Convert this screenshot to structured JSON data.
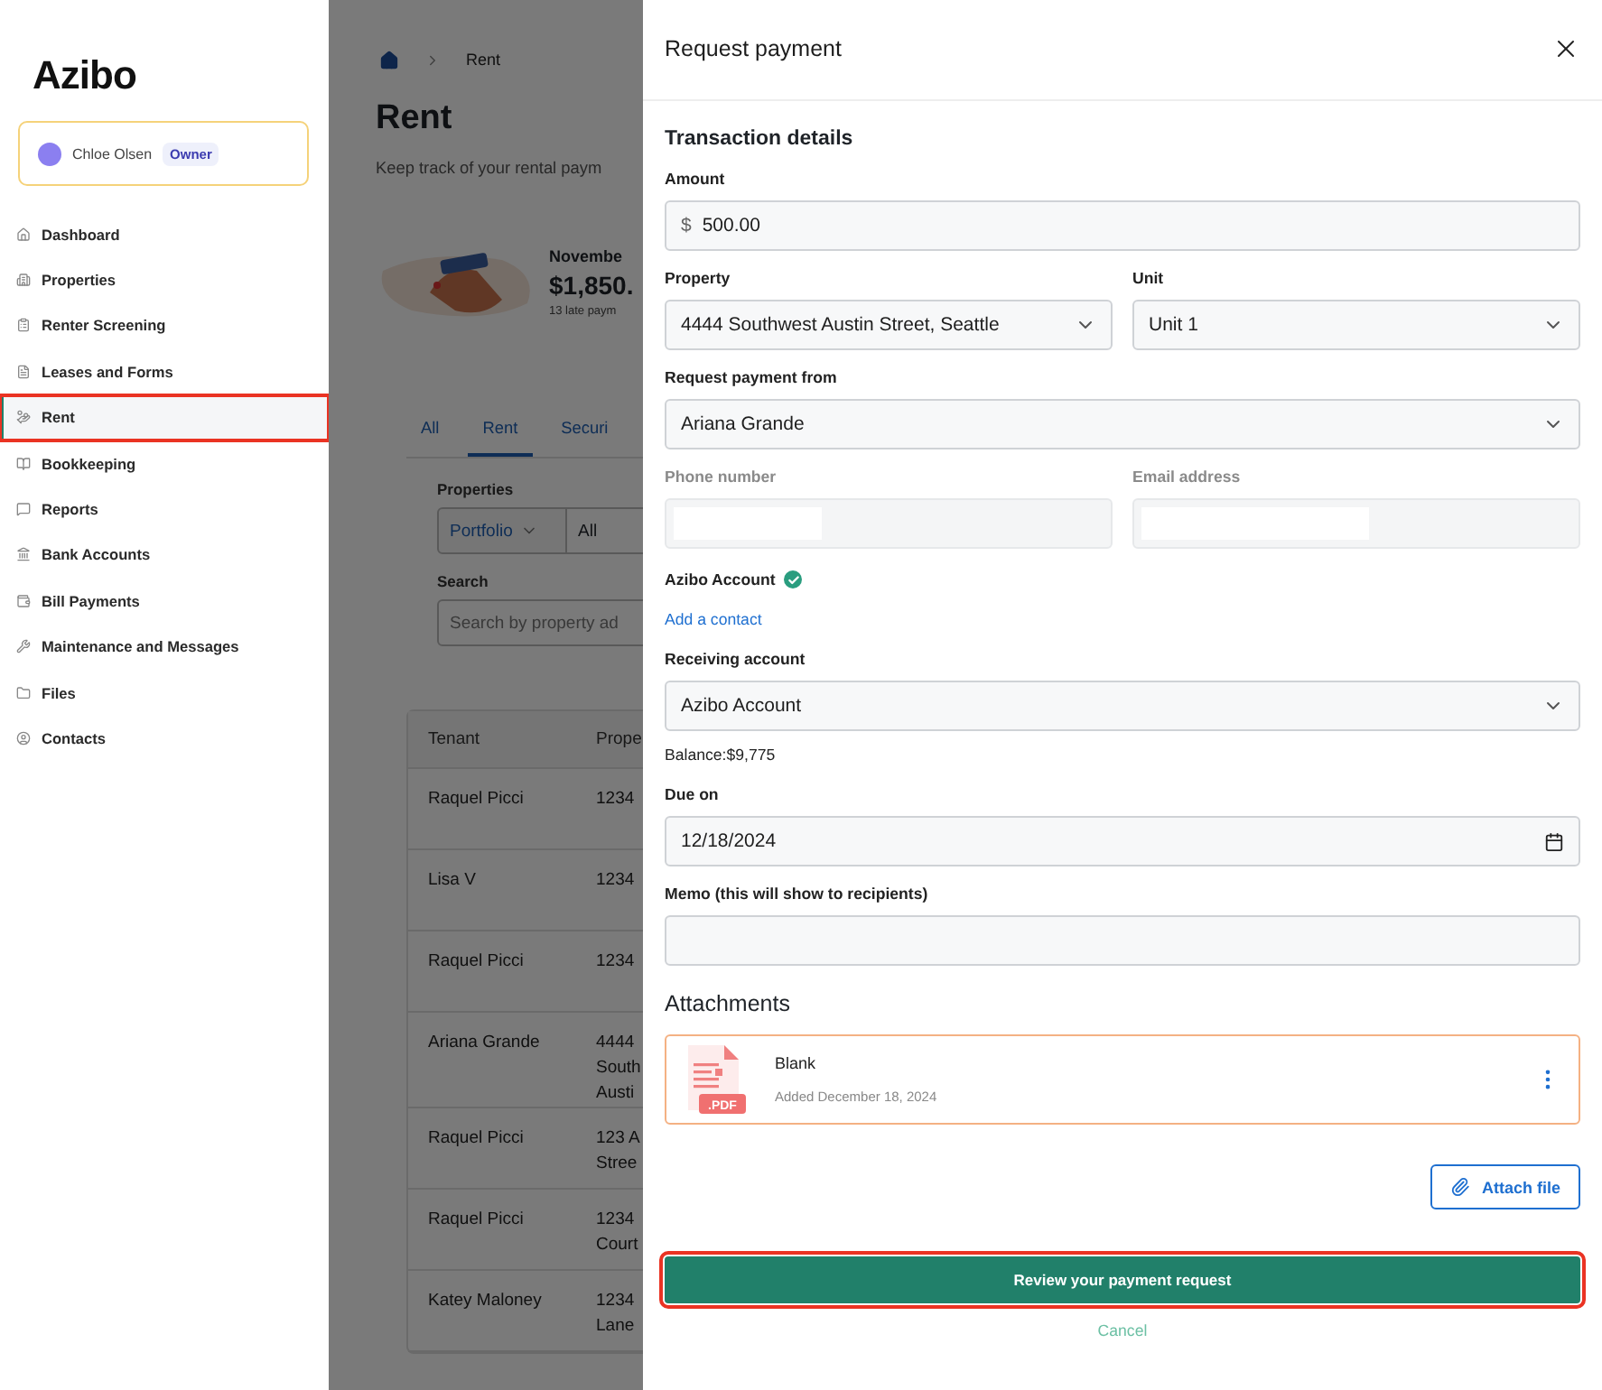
{
  "sidebar": {
    "logo": "Azibo",
    "user": {
      "name": "Chloe Olsen",
      "role": "Owner"
    },
    "items": [
      {
        "label": "Dashboard",
        "selected": false
      },
      {
        "label": "Properties",
        "selected": false
      },
      {
        "label": "Renter Screening",
        "selected": false
      },
      {
        "label": "Leases and Forms",
        "selected": false
      },
      {
        "label": "Rent",
        "selected": true
      },
      {
        "label": "Bookkeeping",
        "selected": false
      },
      {
        "label": "Reports",
        "selected": false
      },
      {
        "label": "Bank Accounts",
        "selected": false
      },
      {
        "label": "Bill Payments",
        "selected": false
      },
      {
        "label": "Maintenance and Messages",
        "selected": false
      },
      {
        "label": "Files",
        "selected": false
      },
      {
        "label": "Contacts",
        "selected": false
      }
    ]
  },
  "page": {
    "breadcrumb": "Rent",
    "title": "Rent",
    "subtitle": "Keep track of your rental paym",
    "summary": {
      "month": "Novembe",
      "amount": "$1,850.",
      "note": "13 late paym"
    },
    "tabs": [
      {
        "label": "All",
        "selected": false
      },
      {
        "label": "Rent",
        "selected": true
      },
      {
        "label": "Securi",
        "selected": false
      }
    ],
    "filters": {
      "properties_label": "Properties",
      "scope": "Portfolio",
      "value": "All",
      "search_label": "Search",
      "search_placeholder": "Search by property ad"
    },
    "table": {
      "columns": [
        "Tenant",
        "Prope"
      ],
      "rows": [
        {
          "tenant": "Raquel Picci",
          "property": [
            "1234"
          ]
        },
        {
          "tenant": "Lisa V",
          "property": [
            "1234"
          ]
        },
        {
          "tenant": "Raquel Picci",
          "property": [
            "1234"
          ]
        },
        {
          "tenant": "Ariana Grande",
          "property": [
            "4444",
            "South",
            "Austi"
          ]
        },
        {
          "tenant": "Raquel Picci",
          "property": [
            "123 A",
            "Stree"
          ]
        },
        {
          "tenant": "Raquel Picci",
          "property": [
            "1234",
            "Court"
          ]
        },
        {
          "tenant": "Katey Maloney",
          "property": [
            "1234",
            "Lane"
          ]
        }
      ]
    }
  },
  "panel": {
    "title": "Request payment",
    "section": "Transaction details",
    "amount": {
      "label": "Amount",
      "prefix": "$",
      "value": "500.00"
    },
    "property": {
      "label": "Property",
      "value": "4444 Southwest Austin Street, Seattle"
    },
    "unit": {
      "label": "Unit",
      "value": "Unit 1"
    },
    "payer": {
      "label": "Request payment from",
      "value": "Ariana Grande"
    },
    "phone": {
      "label": "Phone number",
      "disabled": true
    },
    "email": {
      "label": "Email address",
      "disabled": true
    },
    "account_status": {
      "label": "Azibo Account",
      "verified": true
    },
    "add_contact": "Add a contact",
    "receiving": {
      "label": "Receiving account",
      "value": "Azibo Account"
    },
    "balance": "Balance:$9,775",
    "due": {
      "label": "Due on",
      "value": "12/18/2024"
    },
    "memo": {
      "label": "Memo (this will show to recipients)"
    },
    "attachments_title": "Attachments",
    "attachments": [
      {
        "name": "Blank",
        "added": "Added December 18, 2024",
        "badge": ".PDF"
      }
    ],
    "attach_button": "Attach file",
    "submit": "Review your payment request",
    "cancel": "Cancel"
  }
}
